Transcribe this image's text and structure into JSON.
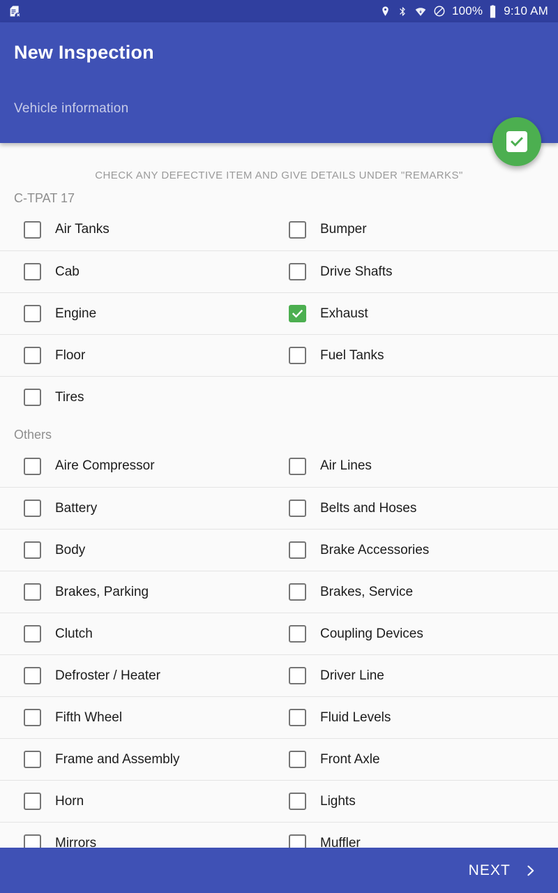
{
  "statusbar": {
    "sim_icon": "sim-card-missing-icon",
    "icons": [
      "location-pin-icon",
      "bluetooth-icon",
      "wifi-icon",
      "do-not-disturb-icon"
    ],
    "battery_percent": "100%",
    "battery_icon": "battery-full-icon",
    "time": "9:10 AM"
  },
  "appbar": {
    "title": "New Inspection",
    "subtitle": "Vehicle information",
    "fab_icon": "check-box-icon"
  },
  "content": {
    "hint": "CHECK ANY DEFECTIVE ITEM AND GIVE DETAILS UNDER \"REMARKS\"",
    "sections": [
      {
        "label": "C-TPAT 17",
        "rows": [
          [
            {
              "label": "Air Tanks",
              "checked": false
            },
            {
              "label": "Bumper",
              "checked": false
            }
          ],
          [
            {
              "label": "Cab",
              "checked": false
            },
            {
              "label": "Drive Shafts",
              "checked": false
            }
          ],
          [
            {
              "label": "Engine",
              "checked": false
            },
            {
              "label": "Exhaust",
              "checked": true
            }
          ],
          [
            {
              "label": "Floor",
              "checked": false
            },
            {
              "label": "Fuel Tanks",
              "checked": false
            }
          ],
          [
            {
              "label": "Tires",
              "checked": false
            },
            null
          ]
        ]
      },
      {
        "label": "Others",
        "rows": [
          [
            {
              "label": "Aire Compressor",
              "checked": false
            },
            {
              "label": "Air Lines",
              "checked": false
            }
          ],
          [
            {
              "label": "Battery",
              "checked": false
            },
            {
              "label": "Belts and Hoses",
              "checked": false
            }
          ],
          [
            {
              "label": "Body",
              "checked": false
            },
            {
              "label": "Brake Accessories",
              "checked": false
            }
          ],
          [
            {
              "label": "Brakes, Parking",
              "checked": false
            },
            {
              "label": "Brakes, Service",
              "checked": false
            }
          ],
          [
            {
              "label": "Clutch",
              "checked": false
            },
            {
              "label": "Coupling Devices",
              "checked": false
            }
          ],
          [
            {
              "label": "Defroster / Heater",
              "checked": false
            },
            {
              "label": "Driver Line",
              "checked": false
            }
          ],
          [
            {
              "label": "Fifth Wheel",
              "checked": false
            },
            {
              "label": "Fluid Levels",
              "checked": false
            }
          ],
          [
            {
              "label": "Frame and Assembly",
              "checked": false
            },
            {
              "label": "Front Axle",
              "checked": false
            }
          ],
          [
            {
              "label": "Horn",
              "checked": false
            },
            {
              "label": "Lights",
              "checked": false
            }
          ],
          [
            {
              "label": "Mirrors",
              "checked": false
            },
            {
              "label": "Muffler",
              "checked": false
            }
          ]
        ]
      }
    ]
  },
  "bottombar": {
    "next_label": "NEXT",
    "next_icon": "chevron-right-icon"
  },
  "colors": {
    "appbar": "#3f51b5",
    "statusbar": "#303f9f",
    "accent_green": "#4caf50",
    "background": "#fafafa",
    "divider": "#e4e4e4"
  }
}
